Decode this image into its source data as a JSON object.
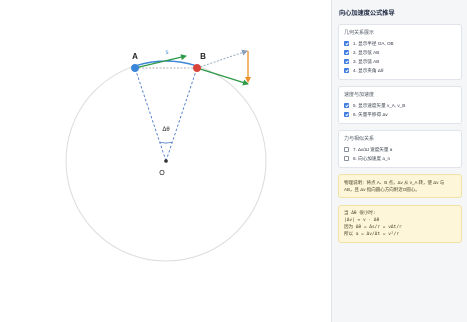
{
  "panel": {
    "title": "向心加速度公式推导",
    "sections": [
      {
        "title": "几何关系展示",
        "options": [
          {
            "label": "1. 显示半径 OA, OB",
            "checked": true
          },
          {
            "label": "2. 显示弦 AB",
            "checked": true
          },
          {
            "label": "3. 显示弧 AB",
            "checked": true
          },
          {
            "label": "4. 显示夹角 Δθ",
            "checked": true
          }
        ]
      },
      {
        "title": "速度与加速度",
        "options": [
          {
            "label": "5. 显示速度矢量 v_A, v_B",
            "checked": true
          },
          {
            "label": "6. 矢量平移得 Δv",
            "checked": true
          }
        ]
      },
      {
        "title": "力与相似关系",
        "options": [
          {
            "label": "7. Δv/Δt 速度矢量 a",
            "checked": false
          },
          {
            "label": "8. 向心加速度 a_n",
            "checked": false
          }
        ]
      }
    ],
    "note": "物理说明：将点 A、B 点，Δv 从 v_A 转，使 Δv 与 AB，且 Δv 指向圆心方向附近O圆心。",
    "formula": {
      "lines": [
        "当 Δθ 很小时:",
        "|Δv| ≈ v · Δθ",
        "因为 Δθ = Δs/r = vΔt/r",
        "所以 a = Δv/Δt = v²/r"
      ]
    }
  },
  "diagram": {
    "point_labels": {
      "a": "A",
      "b": "B",
      "o": "O"
    },
    "angle_label": "Δθ",
    "arc_label": "s",
    "colors": {
      "point_a": "#3a86d8",
      "point_b": "#d9443a",
      "velocity_a": "#2e9a48",
      "velocity_b": "#2e9a48",
      "delta_v": "#ef8e2a",
      "radius": "#4a78c8",
      "circle": "#dcdcdc",
      "chord": "#999999",
      "arc": "#3a86d8",
      "translated": "#8aa0b8"
    }
  }
}
